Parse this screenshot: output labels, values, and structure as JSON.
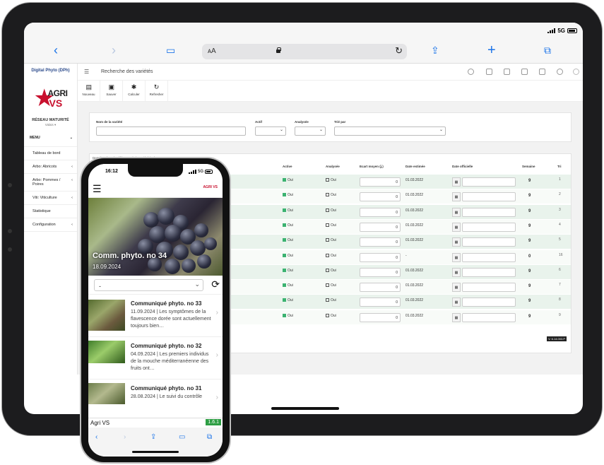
{
  "tablet": {
    "status": {
      "network": "5G"
    },
    "app": {
      "title": "Digital Phyto (DPh)",
      "page_title": "Recherche des variétés",
      "logo": {
        "line1": "AGRI",
        "line2": "VS"
      },
      "network_name": "RÉSEAU MATURITÉ",
      "network_sub": "Valais ▾",
      "menu_label": "MENU",
      "menu_items": [
        {
          "label": "Tableau de bord"
        },
        {
          "label": "Arbo: Abricots"
        },
        {
          "label": "Arbo: Pommes / Poires"
        },
        {
          "label": "Viti: Viticulture"
        },
        {
          "label": "Statistique"
        },
        {
          "label": "Configuration"
        }
      ],
      "toolbar": [
        {
          "label": "Nouveau",
          "icon": "file-icon"
        },
        {
          "label": "Sauver",
          "icon": "save-icon"
        },
        {
          "label": "Calculer",
          "icon": "gear-icon"
        },
        {
          "label": "Refresher",
          "icon": "refresh-icon"
        }
      ],
      "filters": {
        "name_label": "Nom de la variété",
        "active_label": "Actif",
        "analysed_label": "Analysée",
        "sort_label": "Trié par"
      },
      "table": {
        "caption": "Dernière date de référence de la variété (Jul.e",
        "headers": [
          "Active",
          "Analysée",
          "Ecart moyen (j.)",
          "Date estimée",
          "Date officielle",
          "Semaine",
          "Tri"
        ],
        "rows": [
          {
            "active": "Oui",
            "analysed": "Oui",
            "ecart": "0",
            "date_est": "01.03.2022",
            "semaine": "9",
            "tri": "1"
          },
          {
            "active": "Oui",
            "analysed": "Oui",
            "ecart": "0",
            "date_est": "01.03.2022",
            "semaine": "9",
            "tri": "2"
          },
          {
            "active": "Oui",
            "analysed": "Oui",
            "ecart": "0",
            "date_est": "01.03.2022",
            "semaine": "9",
            "tri": "3"
          },
          {
            "active": "Oui",
            "analysed": "Oui",
            "ecart": "0",
            "date_est": "01.03.2022",
            "semaine": "9",
            "tri": "4"
          },
          {
            "active": "Oui",
            "analysed": "Oui",
            "ecart": "0",
            "date_est": "01.03.2022",
            "semaine": "9",
            "tri": "5"
          },
          {
            "active": "Oui",
            "analysed": "Oui",
            "ecart": "0",
            "date_est": "-",
            "semaine": "0",
            "tri": "16"
          },
          {
            "active": "Oui",
            "analysed": "Oui",
            "ecart": "0",
            "date_est": "01.03.2022",
            "semaine": "9",
            "tri": "6"
          },
          {
            "active": "Oui",
            "analysed": "Oui",
            "ecart": "0",
            "date_est": "01.03.2022",
            "semaine": "9",
            "tri": "7"
          },
          {
            "active": "Oui",
            "analysed": "Oui",
            "ecart": "0",
            "date_est": "01.03.2022",
            "semaine": "9",
            "tri": "8"
          },
          {
            "active": "Oui",
            "analysed": "Oui",
            "ecart": "0",
            "date_est": "01.03.2022",
            "semaine": "9",
            "tri": "9"
          }
        ]
      },
      "version": "V. 6.14.003.P"
    }
  },
  "phone": {
    "status": {
      "time": "16:12",
      "network": "5G"
    },
    "header_logo": "AGRI VS",
    "hero": {
      "title": "Comm. phyto. no 34",
      "date": "18.09.2024"
    },
    "select_value": "-",
    "news": [
      {
        "title": "Communiqué phyto. no 33",
        "text": "11.09.2024 | Les symptômes de la flavescence dorée sont actuellement toujours bien…"
      },
      {
        "title": "Communiqué phyto. no 32",
        "text": "04.09.2024 | Les premiers individus de la mouche méditerranéenne des fruits ont…"
      },
      {
        "title": "Communiqué phyto. no 31",
        "text": "28.08.2024 | Le suivi du contrôle"
      }
    ],
    "footer": {
      "app_name": "Agri VS",
      "version": "1.6.1"
    }
  }
}
